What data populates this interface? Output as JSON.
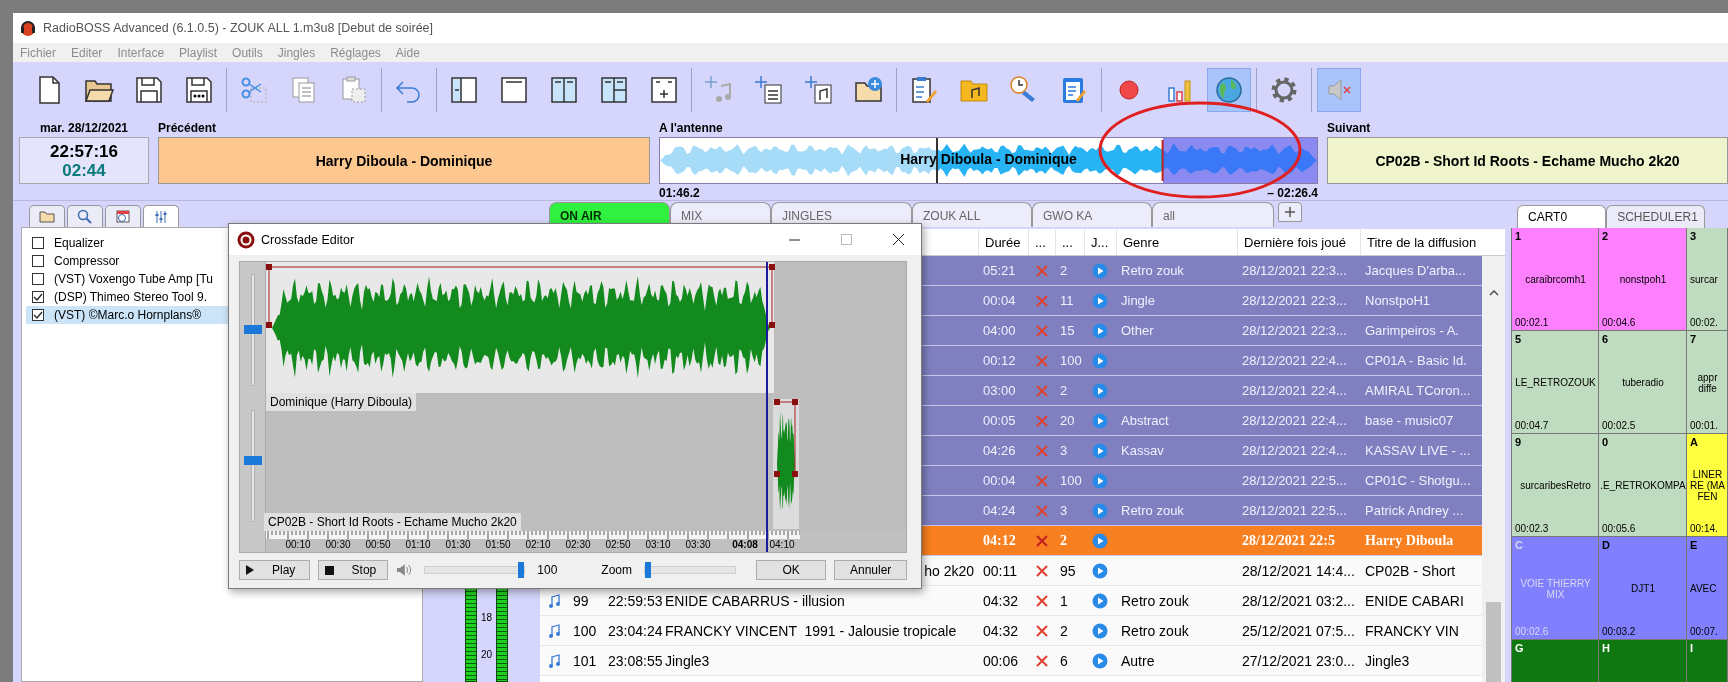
{
  "window": {
    "title": "RadioBOSS Advanced (6.1.0.5) - ZOUK ALL 1.m3u8 [Debut de soirée]"
  },
  "menu": [
    "Fichier",
    "Editer",
    "Interface",
    "Playlist",
    "Outils",
    "Jingles",
    "Réglages",
    "Aide"
  ],
  "toolbar": {
    "groups": [
      [
        {
          "pressed": false
        },
        {
          "pressed": false
        },
        {
          "pressed": false
        },
        {
          "pressed": false
        }
      ],
      [
        {
          "pressed": false
        },
        {
          "pressed": false
        },
        {
          "pressed": false
        }
      ],
      [
        {
          "pressed": false
        }
      ],
      [
        {
          "pressed": false
        },
        {
          "pressed": false
        },
        {
          "pressed": false
        },
        {
          "pressed": false
        },
        {
          "pressed": false
        }
      ],
      [
        {
          "pressed": false
        },
        {
          "pressed": false
        },
        {
          "pressed": false
        },
        {
          "pressed": false
        }
      ],
      [
        {
          "pressed": false
        },
        {
          "pressed": false
        },
        {
          "pressed": false
        },
        {
          "pressed": false
        }
      ],
      [
        {
          "pressed": false
        },
        {
          "pressed": false
        },
        {
          "pressed": true
        }
      ],
      [
        {
          "pressed": false
        }
      ],
      [
        {
          "pressed": true
        }
      ]
    ]
  },
  "now_playing": {
    "date": "mar. 28/12/2021",
    "clock": "22:57:16",
    "countdown": "02:44",
    "previous": {
      "label": "Précédent",
      "title": "Harry Diboula - Dominique"
    },
    "on_air": {
      "label": "A l'antenne",
      "title": "Harry Diboula - Dominique",
      "level": 0.42,
      "elapsed": "01:46.2",
      "remaining": "– 02:26.4"
    },
    "next": {
      "label": "Suivant",
      "title": "CP02B - Short Id Roots - Echame Mucho 2k20"
    }
  },
  "left_panel": {
    "tabs": [
      {
        "selected": false
      },
      {
        "selected": false
      },
      {
        "selected": false
      },
      {
        "selected": true
      }
    ],
    "plugins": [
      {
        "name": "Equalizer",
        "checked": false,
        "selected": false
      },
      {
        "name": "Compressor",
        "checked": false,
        "selected": false
      },
      {
        "name": "(VST) Voxengo Tube Amp [Tu",
        "checked": false,
        "selected": false
      },
      {
        "name": "(DSP) Thimeo Stereo Tool 9.",
        "checked": true,
        "selected": false
      },
      {
        "name": "(VST) ©Marc.o Hornplans®",
        "checked": true,
        "selected": true
      }
    ],
    "meter_labels": [
      "18",
      "20"
    ]
  },
  "playlist": {
    "tabs": [
      {
        "label": "ON AIR",
        "selected": true
      },
      {
        "label": "MIX",
        "selected": false
      },
      {
        "label": "JINGLES",
        "selected": false
      },
      {
        "label": "ZOUK ALL",
        "selected": false
      },
      {
        "label": "GWO KA",
        "selected": false
      },
      {
        "label": "all",
        "selected": false
      }
    ],
    "columns": [
      "Durée",
      "...",
      "...",
      "J...",
      "Genre",
      "Dernière fois joué",
      "Titre de la diffusion"
    ],
    "rows": [
      {
        "kind": "played",
        "duration": "05:21",
        "count": "2",
        "genre": "Retro zouk",
        "last_played": "28/12/2021 22:3...",
        "broadcast_title": "Jacques D'arba..."
      },
      {
        "kind": "played",
        "duration": "00:04",
        "count": "11",
        "genre": "Jingle",
        "last_played": "28/12/2021 22:3...",
        "broadcast_title": "NonstpoH1"
      },
      {
        "kind": "played",
        "duration": "04:00",
        "count": "15",
        "genre": "Other",
        "last_played": "28/12/2021 22:3...",
        "broadcast_title": "Garimpeiros - A."
      },
      {
        "kind": "played",
        "duration": "00:12",
        "count": "100",
        "last_played": "28/12/2021 22:4...",
        "broadcast_title": "CP01A - Basic Id."
      },
      {
        "kind": "played",
        "duration": "03:00",
        "count": "2",
        "last_played": "28/12/2021 22:4...",
        "broadcast_title": "AMIRAL TCoron..."
      },
      {
        "kind": "played",
        "duration": "00:05",
        "count": "20",
        "genre": "Abstract",
        "last_played": "28/12/2021 22:4...",
        "broadcast_title": "base - music07"
      },
      {
        "kind": "played",
        "duration": "04:26",
        "count": "3",
        "genre": "Kassav",
        "last_played": "28/12/2021 22:4...",
        "broadcast_title": "KASSAV LIVE - ..."
      },
      {
        "kind": "played",
        "duration": "00:04",
        "count": "100",
        "last_played": "28/12/2021 22:5...",
        "broadcast_title": "CP01C - Shotgu..."
      },
      {
        "kind": "played",
        "duration": "04:24",
        "count": "3",
        "genre": "Retro zouk",
        "last_played": "28/12/2021 22:5...",
        "broadcast_title": "Patrick Andrey ..."
      },
      {
        "kind": "playing",
        "duration": "04:12",
        "count": "2",
        "last_played": "28/12/2021 22:5",
        "broadcast_title": "Harry Diboula"
      },
      {
        "kind": "queued",
        "title": "ho 2k20",
        "title_cut_start": true,
        "duration": "00:11",
        "count": "95",
        "last_played": "28/12/2021 14:4...",
        "broadcast_title": "CP02B - Short"
      },
      {
        "kind": "queued",
        "number": "99",
        "time": "22:59:53",
        "title": "ENIDE CABARRUS - illusion",
        "title_cut_start": false,
        "duration": "04:32",
        "count": "1",
        "genre": "Retro zouk",
        "last_played": "28/12/2021 03:2...",
        "broadcast_title": "ENIDE CABARI"
      },
      {
        "kind": "queued",
        "number": "100",
        "time": "23:04:24",
        "title": "FRANCKY VINCENT  1991 - Jalousie tropicale",
        "title_cut_start": false,
        "duration": "04:32",
        "count": "2",
        "genre": "Retro zouk",
        "last_played": "25/12/2021 07:5...",
        "broadcast_title": "FRANCKY VIN"
      },
      {
        "kind": "queued",
        "number": "101",
        "time": "23:08:55",
        "title": "Jingle3",
        "title_cut_start": false,
        "duration": "00:06",
        "count": "6",
        "genre": "Autre",
        "last_played": "27/12/2021 23:0...",
        "broadcast_title": "Jingle3"
      }
    ]
  },
  "cart": {
    "tabs": [
      {
        "label": "CART0",
        "selected": true
      },
      {
        "label": "SCHEDULER1",
        "selected": false
      }
    ],
    "rows": [
      [
        {
          "key": "1",
          "name": "caraibrcomh1",
          "duration": "00:02.1",
          "color": "#ff80ff",
          "dimmed": false
        },
        {
          "key": "2",
          "name": "nonstpoh1",
          "duration": "00:04.6",
          "color": "#ff80ff",
          "dimmed": false
        },
        {
          "key": "3",
          "name": "surcar",
          "duration": "00:02.",
          "color": "#c0dcc0",
          "dimmed": false
        }
      ],
      [
        {
          "key": "5",
          "name": "LE_RETROZOUK",
          "duration": "00:04.7",
          "color": "#c0dcc0",
          "dimmed": false
        },
        {
          "key": "6",
          "name": "tuberadio",
          "duration": "00:02.5",
          "color": "#c0dcc0",
          "dimmed": false
        },
        {
          "key": "7",
          "name": "appr diffe",
          "duration": "00:01.",
          "color": "#c0dcc0",
          "dimmed": false
        }
      ],
      [
        {
          "key": "9",
          "name": "surcaribesRetro",
          "duration": "00:02.3",
          "color": "#c0dcc0",
          "dimmed": false
        },
        {
          "key": "0",
          "name": ".E_RETROKOMPA",
          "duration": "00:05.6",
          "color": "#c0dcc0",
          "dimmed": false
        },
        {
          "key": "A",
          "name": "LINER RE (MA FEN",
          "duration": "00:14.",
          "color": "#ffff40",
          "dimmed": false
        }
      ],
      [
        {
          "key": "C",
          "name": "VOIE THIERRY MIX",
          "duration": "00:02.6",
          "color": "#8080ff",
          "dimmed": true
        },
        {
          "key": "D",
          "name": "DJT1",
          "duration": "00:03.2",
          "color": "#8080ff",
          "dimmed": false
        },
        {
          "key": "E",
          "name": "AVEC",
          "duration": "00:07.",
          "color": "#8080ff",
          "dimmed": false
        }
      ],
      [
        {
          "key": "G",
          "color": "#107810",
          "dimmed": false
        },
        {
          "key": "H",
          "color": "#107810",
          "dimmed": false
        },
        {
          "key": "I",
          "color": "#107810",
          "dimmed": false
        }
      ]
    ]
  },
  "crossfade_editor": {
    "title": "Crossfade Editor",
    "tracks": [
      {
        "label": "Dominique (Harry Diboula)",
        "level": 0.5
      },
      {
        "label": "CP02B - Short Id Roots - Echame Mucho 2k20",
        "level": 0.55
      }
    ],
    "ticks": [
      "00:10",
      "00:30",
      "00:50",
      "01:10",
      "01:30",
      "01:50",
      "02:10",
      "02:30",
      "02:50",
      "03:10",
      "03:30"
    ],
    "marker": "04:08",
    "end_tick": "04:10",
    "play": "Play",
    "stop": "Stop",
    "volume": {
      "level": 0.97,
      "reading": "100"
    },
    "zoom": {
      "label": "Zoom",
      "level": 0.03
    },
    "ok": "OK",
    "cancel": "Annuler"
  }
}
